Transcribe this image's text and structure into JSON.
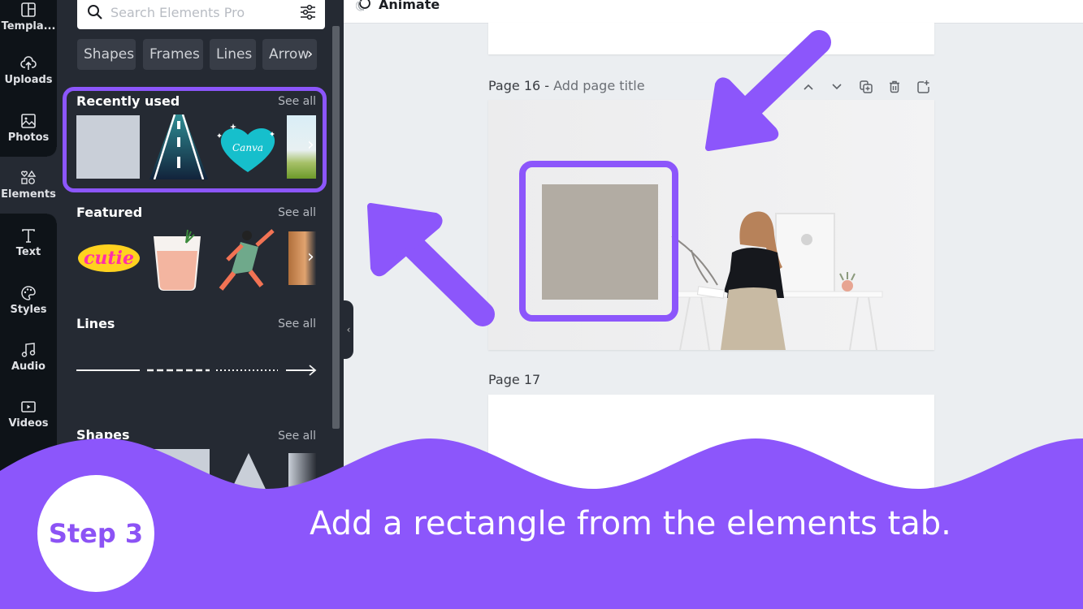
{
  "colors": {
    "accent": "#8c56fb",
    "rail_bg": "#0e1318",
    "panel_bg": "#252a33",
    "canvas_bg": "#ebeef1",
    "placeholder_rect": "#b2aca3"
  },
  "rail": {
    "items": [
      {
        "label": "Templa...",
        "icon": "templates-icon"
      },
      {
        "label": "Uploads",
        "icon": "upload-cloud-icon"
      },
      {
        "label": "Photos",
        "icon": "image-icon"
      },
      {
        "label": "Elements",
        "icon": "shapes-icon",
        "active": true
      },
      {
        "label": "Text",
        "icon": "text-icon"
      },
      {
        "label": "Styles",
        "icon": "palette-icon"
      },
      {
        "label": "Audio",
        "icon": "music-note-icon"
      },
      {
        "label": "Videos",
        "icon": "video-icon"
      }
    ]
  },
  "panel": {
    "search": {
      "placeholder": "Search Elements Pro",
      "value": ""
    },
    "chips": [
      "Shapes",
      "Frames",
      "Lines",
      "Arrow"
    ],
    "sections": [
      {
        "title": "Recently used",
        "see_all": "See all",
        "items": [
          "gray-square",
          "road",
          "canva-heart-sticker",
          "landscape-gradient"
        ]
      },
      {
        "title": "Featured",
        "see_all": "See all",
        "items": [
          "cutie-sticker",
          "iced-drink",
          "dancing-woman",
          "partial-illustration"
        ]
      },
      {
        "title": "Lines",
        "see_all": "See all",
        "items": [
          "solid-line",
          "dashed-line",
          "dotted-line",
          "arrow-line"
        ]
      },
      {
        "title": "Shapes",
        "see_all": "See all",
        "items": [
          "square",
          "triangle",
          "diamond"
        ]
      }
    ]
  },
  "topbar": {
    "animate_label": "Animate"
  },
  "canvas": {
    "page16": {
      "label": "Page 16 -",
      "title_placeholder": "Add page title"
    },
    "page17": {
      "label": "Page 17"
    }
  },
  "banner": {
    "step": "Step 3",
    "instruction": "Add a rectangle from the elements tab."
  }
}
